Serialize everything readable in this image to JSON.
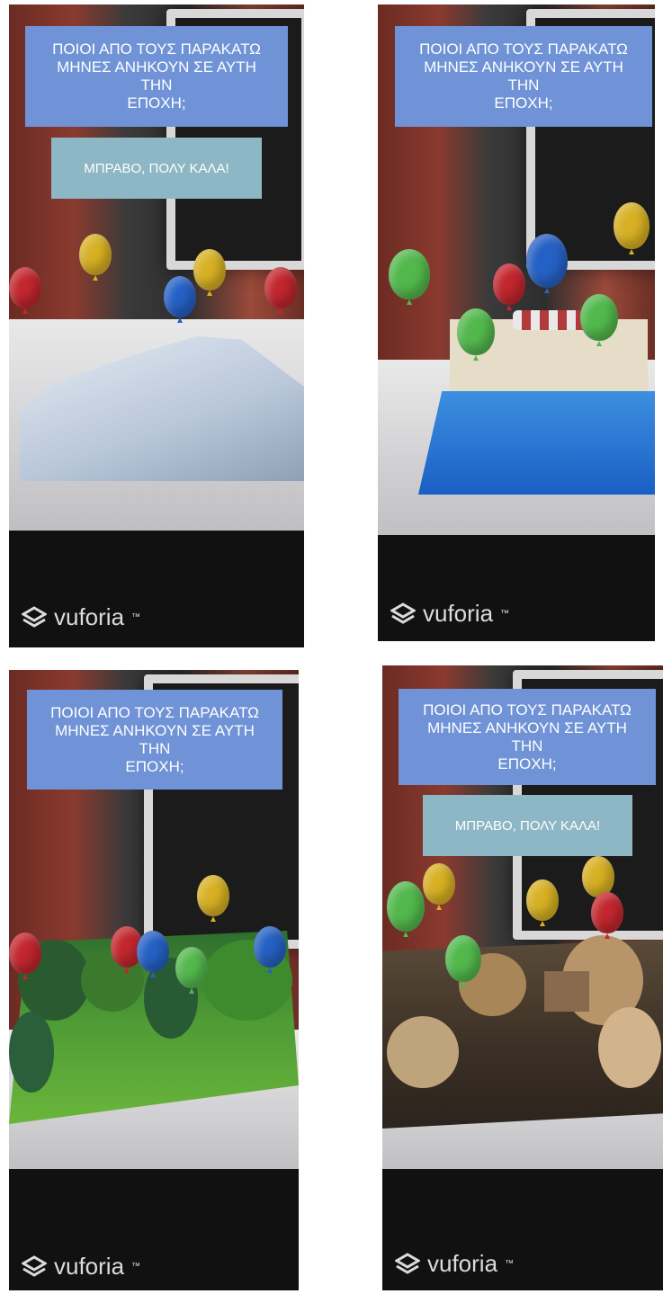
{
  "panels": [
    {
      "id": "winter",
      "question": "ΠΟΙΟΙ ΑΠΟ ΤΟΥΣ ΠΑΡΑΚΑΤΩ\nΜΗΝΕΣ ΑΝΗΚΟΥΝ ΣΕ ΑΥΤΗ ΤΗΝ\nΕΠΟΧΗ;",
      "feedback": "ΜΠΡΑΒΟ, ΠΟΛΥ ΚΑΛΑ!",
      "brand": "vuforia"
    },
    {
      "id": "summer",
      "question": "ΠΟΙΟΙ ΑΠΟ ΤΟΥΣ ΠΑΡΑΚΑΤΩ\nΜΗΝΕΣ ΑΝΗΚΟΥΝ ΣΕ ΑΥΤΗ ΤΗΝ\nΕΠΟΧΗ;",
      "brand": "vuforia"
    },
    {
      "id": "spring",
      "question": "ΠΟΙΟΙ ΑΠΟ ΤΟΥΣ ΠΑΡΑΚΑΤΩ\nΜΗΝΕΣ ΑΝΗΚΟΥΝ ΣΕ ΑΥΤΗ ΤΗΝ\nΕΠΟΧΗ;",
      "brand": "vuforia"
    },
    {
      "id": "autumn",
      "question": "ΠΟΙΟΙ ΑΠΟ ΤΟΥΣ ΠΑΡΑΚΑΤΩ\nΜΗΝΕΣ ΑΝΗΚΟΥΝ ΣΕ ΑΥΤΗ ΤΗΝ\nΕΠΟΧΗ;",
      "feedback": "ΜΠΡΑΒΟ, ΠΟΛΥ ΚΑΛΑ!",
      "brand": "vuforia"
    }
  ],
  "colors": {
    "question_bg": "#6f93d6",
    "feedback_bg": "#8db7c4",
    "balloon_red": "#c3262e",
    "balloon_yellow": "#d7b023",
    "balloon_blue": "#2561c4",
    "balloon_green": "#52b84c"
  },
  "icons": [
    "vuforia-logo-icon"
  ]
}
